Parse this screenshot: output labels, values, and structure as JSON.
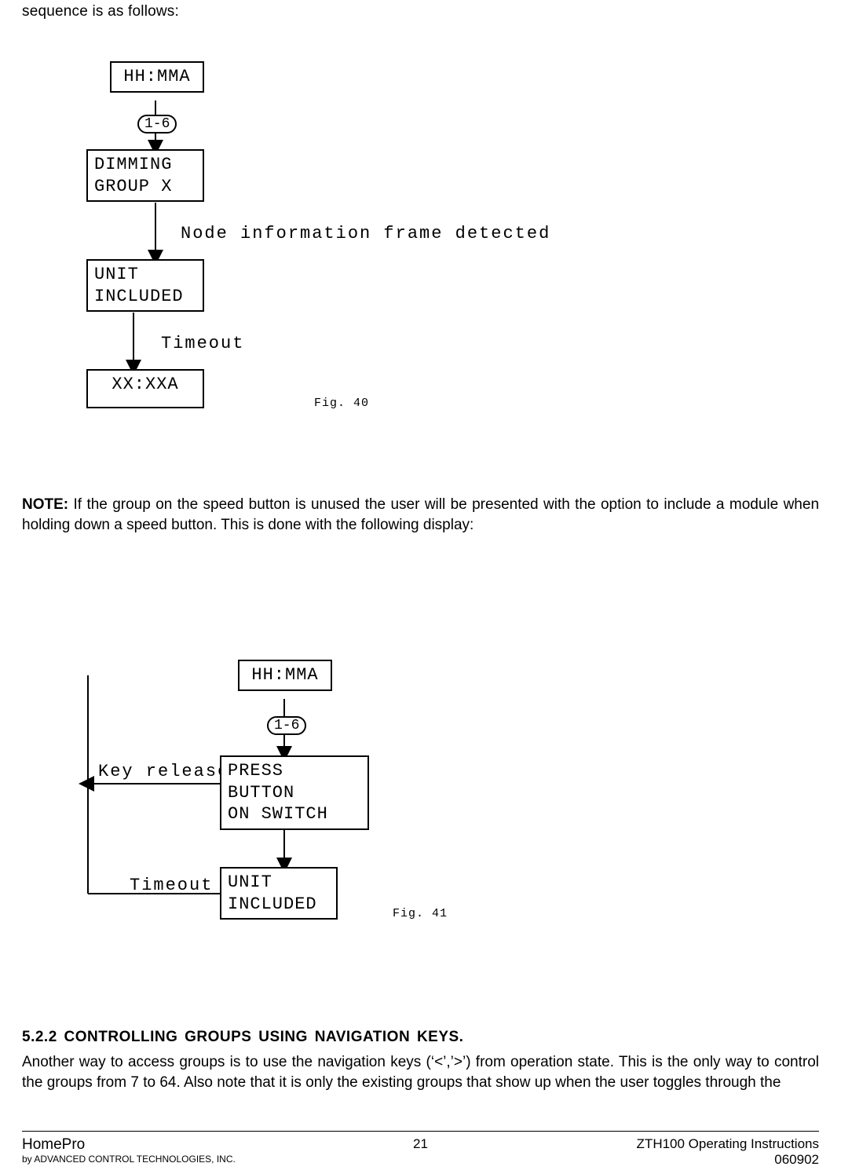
{
  "intro_fragment": "sequence is as follows:",
  "fig40": {
    "box1": "HH:MMA",
    "cap": "1-6",
    "box2_l1": "DIMMING",
    "box2_l2": "GROUP X",
    "arrow2_label": "Node information frame detected",
    "box3_l1": "UNIT",
    "box3_l2": "INCLUDED",
    "arrow3_label": "Timeout",
    "box4": "XX:XXA",
    "caption": "Fig. 40"
  },
  "note": {
    "label": "NOTE:",
    "text": "If the group on the speed button is unused the user will be presented with the option to include a module when holding down a speed button. This is done with the following display:"
  },
  "fig41": {
    "box1": "HH:MMA",
    "cap": "1-6",
    "left_label": "Key released",
    "box2_l1": "PRESS BUTTON",
    "box2_l2": "ON SWITCH",
    "arrow3_label": "Timeout",
    "box3_l1": "UNIT",
    "box3_l2": "INCLUDED",
    "caption": "Fig. 41"
  },
  "section": {
    "heading": "5.2.2 CONTROLLING GROUPS USING NAVIGATION KEYS.",
    "body": "Another way to access groups is to use the navigation keys (‘<’,’>’) from operation state. This is the only way to control the groups from 7 to 64. Also note that it is only the existing groups that show up when the user toggles through the"
  },
  "footer": {
    "brand": "HomePro",
    "sub": "by ADVANCED CONTROL TECHNOLOGIES, INC.",
    "page": "21",
    "doc": "ZTH100 Operating Instructions",
    "date": "060902"
  }
}
